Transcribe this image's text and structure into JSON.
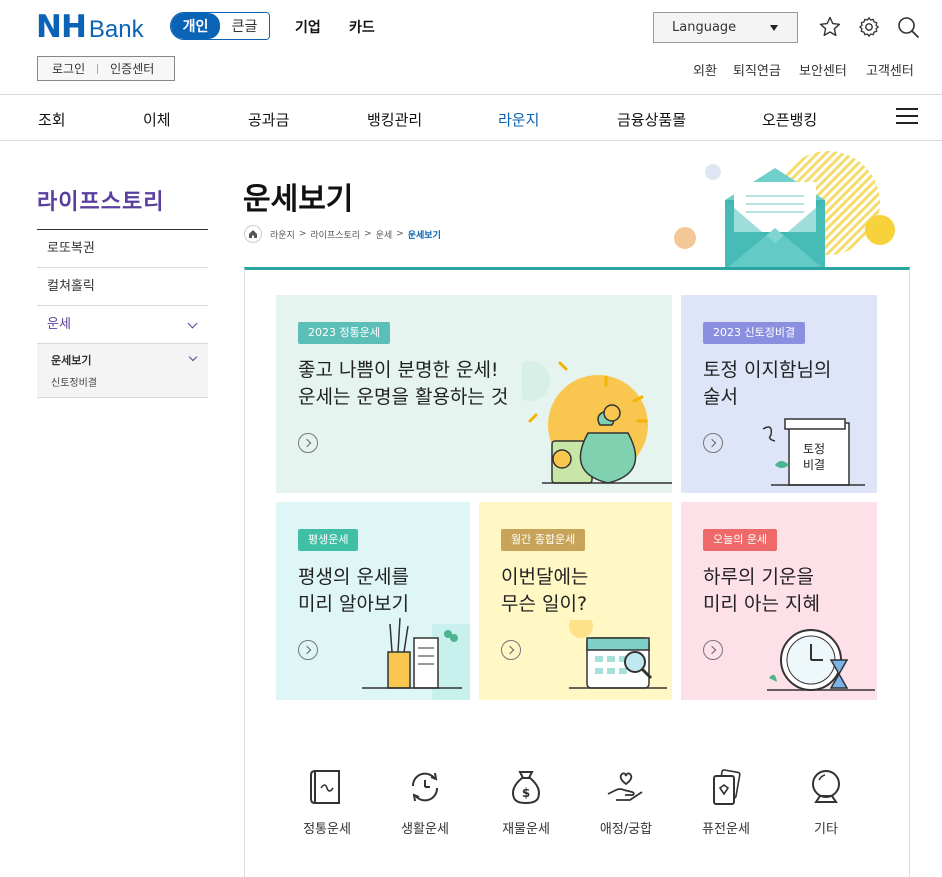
{
  "brand": {
    "nh": "NH",
    "bank": "Bank"
  },
  "segment": {
    "active": "개인",
    "inactive": "큰글"
  },
  "top_links": [
    "기업",
    "카드"
  ],
  "language": {
    "label": "Language"
  },
  "account": {
    "login": "로그인",
    "cert": "인증센터"
  },
  "util_links": [
    "외환",
    "퇴직연금",
    "보안센터",
    "고객센터"
  ],
  "gnb": [
    "조회",
    "이체",
    "공과금",
    "뱅킹관리",
    "라운지",
    "금융상품몰",
    "오픈뱅킹"
  ],
  "lnb": {
    "title": "라이프스토리",
    "items": [
      "로또복권",
      "컬쳐홀릭",
      "운세"
    ],
    "sub_active": "운세보기",
    "sub_other": "신토정비결"
  },
  "page": {
    "title": "운세보기",
    "breadcrumb": [
      "라운지",
      "라이프스토리",
      "운세",
      "운세보기"
    ]
  },
  "cards": [
    {
      "badge": "2023 정통운세",
      "line1": "좋고 나쁨이 분명한 운세!",
      "line2": "운세는 운명을 활용하는 것",
      "badge_color": "#5bbfb7"
    },
    {
      "badge": "2023 신토정비결",
      "line1": "토정 이지함님의",
      "line2": "술서",
      "badge_color": "#8a8fe0",
      "art_text": [
        "토정",
        "비결"
      ]
    },
    {
      "badge": "평생운세",
      "line1": "평생의 운세를",
      "line2": "미리 알아보기",
      "badge_color": "#3fbfa4"
    },
    {
      "badge": "월간 종합운세",
      "line1": "이번달에는",
      "line2": "무슨 일이?",
      "badge_color": "#c7a45a"
    },
    {
      "badge": "오늘의 운세",
      "line1": "하루의 기운을",
      "line2": "미리 아는 지혜",
      "badge_color": "#ee6a6a"
    }
  ],
  "quick": [
    "정통운세",
    "생활운세",
    "재물운세",
    "애정/궁합",
    "퓨전운세",
    "기타"
  ],
  "colors": {
    "brand": "#0a63b5",
    "lnb": "#5a3f9f",
    "teal": "#2aa6a0"
  }
}
